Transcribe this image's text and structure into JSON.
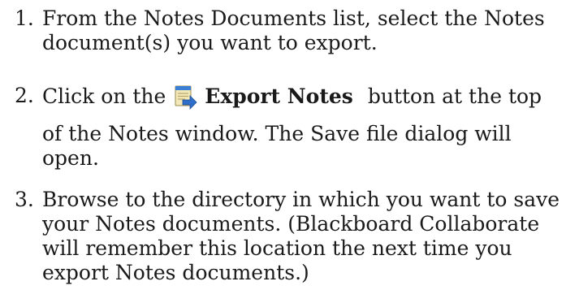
{
  "steps": [
    {
      "number": "1.",
      "lines": [
        "From the Notes Documents list, select the Notes",
        "document(s) you want to export."
      ]
    },
    {
      "number": "2.",
      "before": "Click on the",
      "icon": "export-notes-icon",
      "label": "Export Notes",
      "after": "button at the top",
      "lines": [
        "of the Notes window. The Save file dialog will",
        "open."
      ]
    },
    {
      "number": "3.",
      "lines": [
        "Browse to the directory in which you want to save",
        "your Notes documents. (Blackboard Collaborate",
        "will remember this location the next time you",
        "export Notes documents.)"
      ]
    }
  ]
}
